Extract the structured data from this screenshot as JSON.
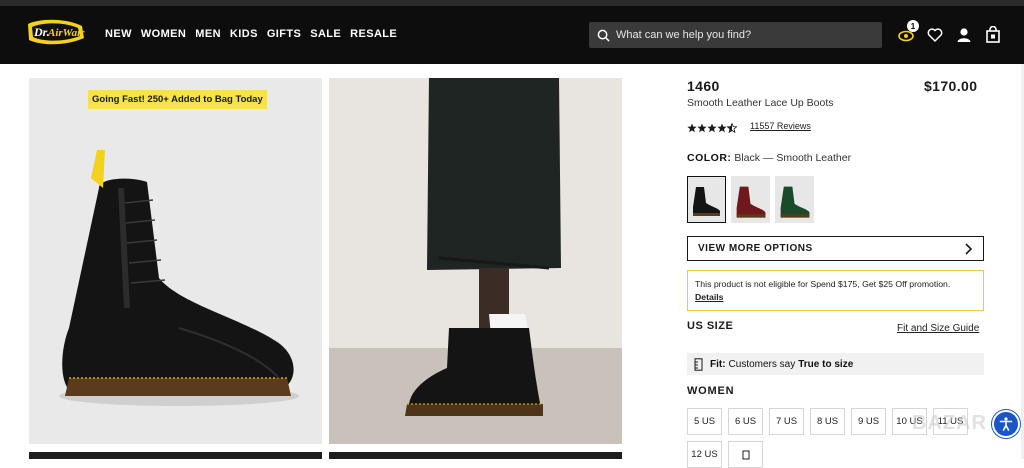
{
  "header": {
    "nav": [
      "NEW",
      "WOMEN",
      "MEN",
      "KIDS",
      "GIFTS",
      "SALE",
      "RESALE"
    ],
    "search_placeholder": "What can we help you find?",
    "loyalty_badge": "1",
    "icons": [
      "search-icon",
      "loyalty-icon",
      "heart-icon",
      "account-icon",
      "bag-icon"
    ]
  },
  "gallery": {
    "badge": "Going Fast! 250+ Added to Bag Today"
  },
  "product": {
    "name": "1460",
    "price": "$170.00",
    "subtitle": "Smooth Leather Lace Up Boots",
    "rating": 4.5,
    "reviews": "11557 Reviews",
    "color_label": "COLOR:",
    "color_value": "Black — Smooth Leather",
    "swatches": [
      "Black",
      "Cherry Red",
      "Green"
    ],
    "view_more": "VIEW MORE OPTIONS",
    "promo_text": "This product is not eligible for Spend $175, Get $25 Off promotion.",
    "promo_link": "Details",
    "size_label": "US SIZE",
    "fit_guide": "Fit and Size Guide",
    "fit_label": "Fit:",
    "fit_text": "Customers say",
    "fit_strong": "True to size",
    "women_label": "WOMEN",
    "sizes": [
      "5 US",
      "6 US",
      "7 US",
      "8 US",
      "9 US",
      "10 US",
      "11 US",
      "12 US"
    ],
    "watermark": "BAZAR"
  },
  "colors": {
    "header_bg": "#0d0d0d",
    "promo_border": "#e8cc3a",
    "badge_bg": "#f7e24b",
    "a11y": "#1a56c9"
  }
}
